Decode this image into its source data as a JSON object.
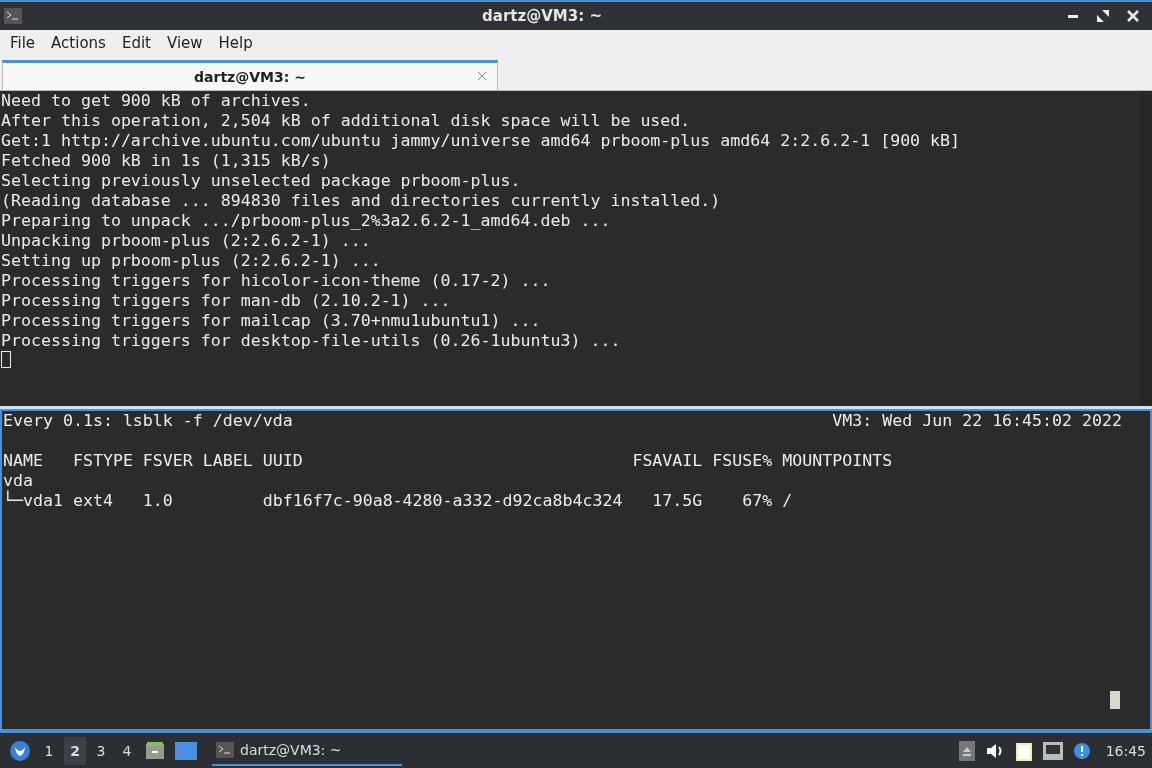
{
  "window": {
    "title": "dartz@VM3: ~"
  },
  "menu": [
    "File",
    "Actions",
    "Edit",
    "View",
    "Help"
  ],
  "tabs": [
    {
      "label": "dartz@VM3: ~",
      "selected": true
    }
  ],
  "top_terminal": {
    "lines": [
      "Need to get 900 kB of archives.",
      "After this operation, 2,504 kB of additional disk space will be used.",
      "Get:1 http://archive.ubuntu.com/ubuntu jammy/universe amd64 prboom-plus amd64 2:2.6.2-1 [900 kB]",
      "Fetched 900 kB in 1s (1,315 kB/s)",
      "Selecting previously unselected package prboom-plus.",
      "(Reading database ... 894830 files and directories currently installed.)",
      "Preparing to unpack .../prboom-plus_2%3a2.6.2-1_amd64.deb ...",
      "Unpacking prboom-plus (2:2.6.2-1) ...",
      "Setting up prboom-plus (2:2.6.2-1) ...",
      "Processing triggers for hicolor-icon-theme (0.17-2) ...",
      "Processing triggers for man-db (2.10.2-1) ...",
      "Processing triggers for mailcap (3.70+nmu1ubuntu1) ...",
      "Processing triggers for desktop-file-utils (0.26-1ubuntu3) ..."
    ]
  },
  "bottom_terminal": {
    "header_left": "Every 0.1s: lsblk -f /dev/vda",
    "header_right": "VM3: Wed Jun 22 16:45:02 2022",
    "lines": [
      "NAME   FSTYPE FSVER LABEL UUID                                 FSAVAIL FSUSE% MOUNTPOINTS",
      "vda",
      "└─vda1 ext4   1.0         dbf16f7c-90a8-4280-a332-d92ca8b4c324   17.5G    67% /"
    ]
  },
  "taskbar": {
    "workspaces": [
      {
        "label": "1",
        "selected": false
      },
      {
        "label": "2",
        "selected": true
      },
      {
        "label": "3",
        "selected": false
      },
      {
        "label": "4",
        "selected": false
      }
    ],
    "task": "dartz@VM3: ~",
    "clock": "16:45"
  }
}
